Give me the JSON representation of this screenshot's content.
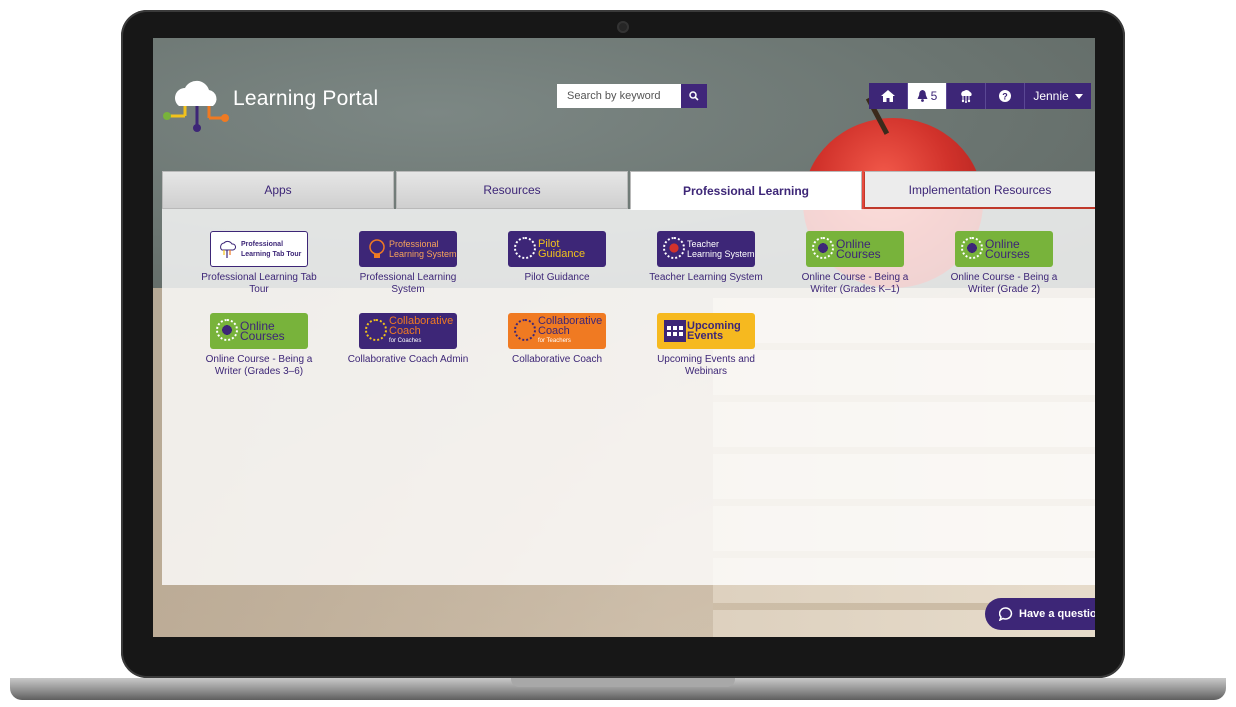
{
  "app": {
    "title": "Learning Portal"
  },
  "search": {
    "placeholder": "Search by keyword"
  },
  "nav": {
    "notifications_count": "5",
    "user_name": "Jennie"
  },
  "tabs": [
    {
      "label": "Apps"
    },
    {
      "label": "Resources"
    },
    {
      "label": "Professional Learning",
      "active": true
    },
    {
      "label": "Implementation Resources"
    }
  ],
  "tiles": [
    {
      "label": "Professional Learning Tab Tour",
      "icon_text": [
        "Professional",
        "Learning Tab Tour"
      ],
      "style": "white"
    },
    {
      "label": "Professional Learning System",
      "icon_text": [
        "Professional",
        "Learning System"
      ],
      "style": "purple"
    },
    {
      "label": "Pilot Guidance",
      "icon_text": [
        "Pilot Guidance"
      ],
      "style": "purple"
    },
    {
      "label": "Teacher Learning System",
      "icon_text": [
        "Teacher",
        "Learning System"
      ],
      "style": "purple"
    },
    {
      "label": "Online Course - Being a Writer (Grades K–1)",
      "icon_text": [
        "Online",
        "Courses"
      ],
      "style": "green"
    },
    {
      "label": "Online Course - Being a Writer (Grade 2)",
      "icon_text": [
        "Online",
        "Courses"
      ],
      "style": "green"
    },
    {
      "label": "Online Course - Being a Writer (Grades 3–6)",
      "icon_text": [
        "Online",
        "Courses"
      ],
      "style": "green"
    },
    {
      "label": "Collaborative Coach Admin",
      "icon_text": [
        "Collaborative",
        "Coach",
        "for Coaches"
      ],
      "style": "purple"
    },
    {
      "label": "Collaborative Coach",
      "icon_text": [
        "Collaborative",
        "Coach",
        "for Teachers"
      ],
      "style": "orange"
    },
    {
      "label": "Upcoming Events and Webinars",
      "icon_text": [
        "Upcoming",
        "Events"
      ],
      "style": "yellow"
    }
  ],
  "help_chat": {
    "label": "Have a questio"
  },
  "colors": {
    "brand_purple": "#3d2677",
    "green": "#78b33b",
    "orange": "#f07a22",
    "yellow": "#f6b91f",
    "tab_accent_red": "#c0392b"
  }
}
